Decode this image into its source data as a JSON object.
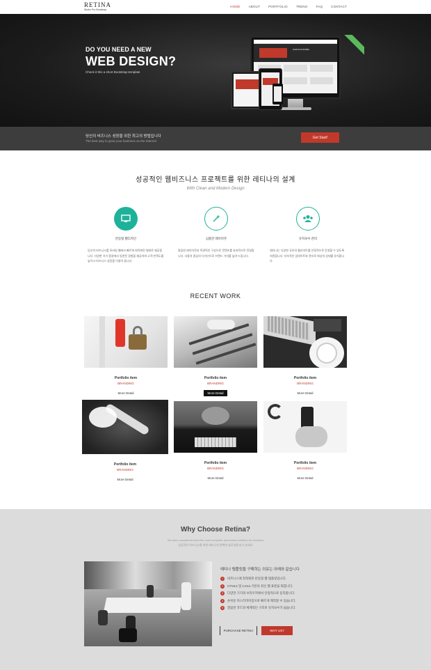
{
  "header": {
    "logo_title": "RETINA",
    "logo_sub": "Studio Pro Bootstrap",
    "nav": [
      "HOME",
      "ABOUT",
      "PORTFOLIO",
      "TRENO",
      "FAQ",
      "CONTACT"
    ],
    "active_index": 0
  },
  "hero": {
    "kicker": "DO YOU NEED A NEW",
    "title": "WEB DESIGN?",
    "desc": "Check it this a short Bootstrap template",
    "device_text": "OUR PLATFORM"
  },
  "cta": {
    "line1": "당신의 비즈니스 성장을 위한 최고의 방법입니다",
    "line2": "The best way to grow your business on the Internet",
    "button": "Get Start!"
  },
  "services": {
    "title": "성공적인 웹비즈니스 프로젝트를 위한 레티나의 설계",
    "subtitle": "With Clean and Modern Design",
    "items": [
      {
        "label": "반응형 웹디자인",
        "text": "당신의 비즈니스를 모바일 웹에서 빠르게 최적화된 형태로 제공합니다. 다양한 기기 환경에서 일관된 경험을 제공하여 고객 만족도를 높이고 비즈니스 성장을 이끌어 줍니다."
      },
      {
        "label": "심플한 레이아웃",
        "text": "깔끔한 레이아웃과 직관적인 구성으로 콘텐츠를 효과적으로 전달합니다. 사용자 중심의 디자인으로 브랜드 가치를 높여 드립니다."
      },
      {
        "label": "유지보수 관리",
        "text": "레티나는 다양한 규모의 웹사이트를 안정적으로 운영할 수 있도록 지원합니다. 지속적인 업데이트와 관리로 최상의 상태를 유지합니다."
      }
    ]
  },
  "recent_work": {
    "title": "RECENT WORK",
    "items": [
      {
        "name": "Portfolio item",
        "category": "BRANDING",
        "button": "More Detail"
      },
      {
        "name": "Portfolio item",
        "category": "BRANDING",
        "button": "More Detail"
      },
      {
        "name": "Portfolio item",
        "category": "BRANDING",
        "button": "More Detail"
      },
      {
        "name": "Portfolio item",
        "category": "BRANDING",
        "button": "More Detail"
      },
      {
        "name": "Portfolio item",
        "category": "BRANDING",
        "button": "More Detail"
      },
      {
        "name": "Portfolio item",
        "category": "BRANDING",
        "button": "More Detail"
      }
    ]
  },
  "why": {
    "title": "Why Choose Retina?",
    "sub1": "We have considered what the most complete and trusted solution for business",
    "sub2": "성공적인 비즈니스를 위한 레티나의 완벽한 솔루션을 만나 보세요",
    "list_title": "레티나 템플릿을 구매하는 이유는 아래와 같습니다",
    "list": [
      "비즈니스에 최적화된 반응형 웹 템플릿입니다.",
      "HTML5 및 CSS3 기반의 최신 웹 표준을 따릅니다.",
      "다양한 기기와 브라우저에서 안정적으로 동작합니다.",
      "손쉬운 커스터마이징으로 빠르게 제작할 수 있습니다.",
      "깔끔한 코드와 체계적인 구조로 유지보수가 쉽습니다."
    ],
    "purchase_button": "PURCHASE RETINA",
    "why_button": "WHY US?"
  }
}
